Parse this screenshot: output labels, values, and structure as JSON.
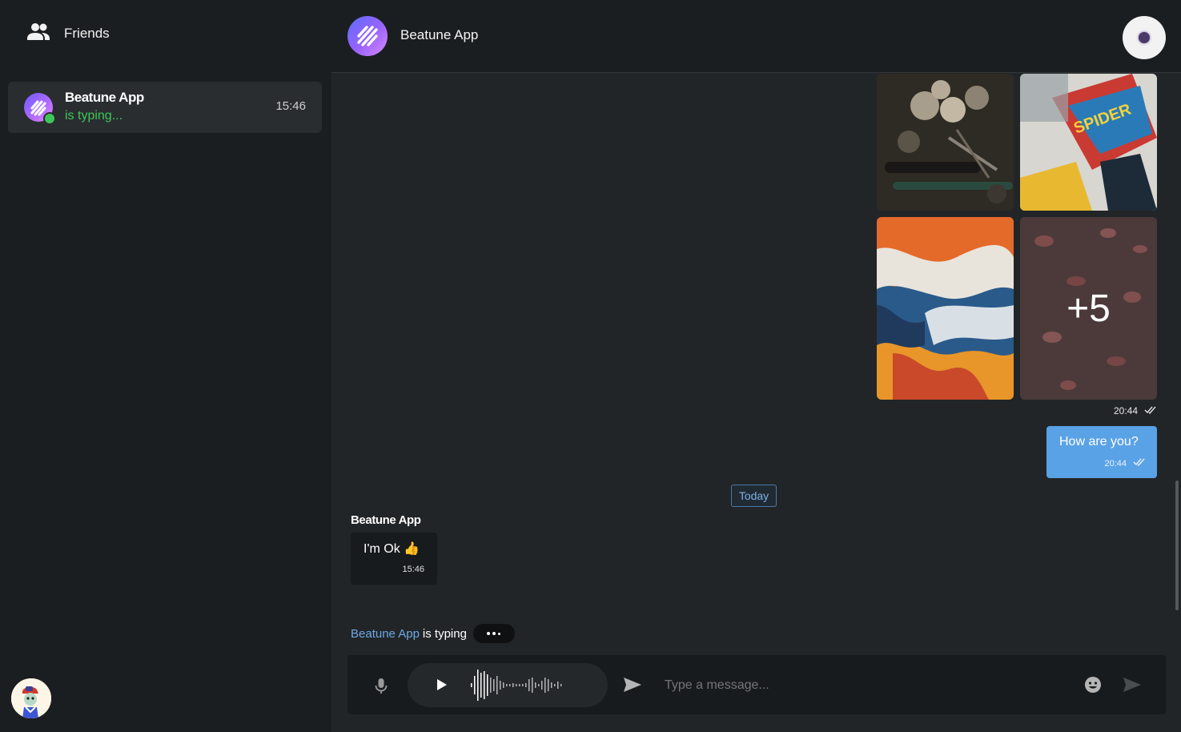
{
  "sidebar": {
    "header_label": "Friends",
    "chats": [
      {
        "name": "Beatune App",
        "status": "is typing...",
        "time": "15:46"
      }
    ]
  },
  "header": {
    "title": "Beatune App"
  },
  "messages": {
    "gallery": {
      "more_count": "+5",
      "time": "20:44"
    },
    "outgoing": {
      "text": "How are you?",
      "time": "20:44"
    },
    "divider": "Today",
    "incoming": {
      "sender": "Beatune App",
      "text": "I'm Ok 👍",
      "time": "15:46"
    }
  },
  "typing": {
    "who": "Beatune App",
    "text": "is typing"
  },
  "composer": {
    "placeholder": "Type a message..."
  },
  "icons": {
    "friends": "people-icon",
    "mic": "microphone-icon",
    "play": "play-icon",
    "send_audio": "send-icon",
    "emoji": "emoji-icon",
    "send": "send-icon"
  },
  "colors": {
    "accent": "#5aa2e6",
    "online": "#3ec65a",
    "link": "#6ea9e8"
  }
}
